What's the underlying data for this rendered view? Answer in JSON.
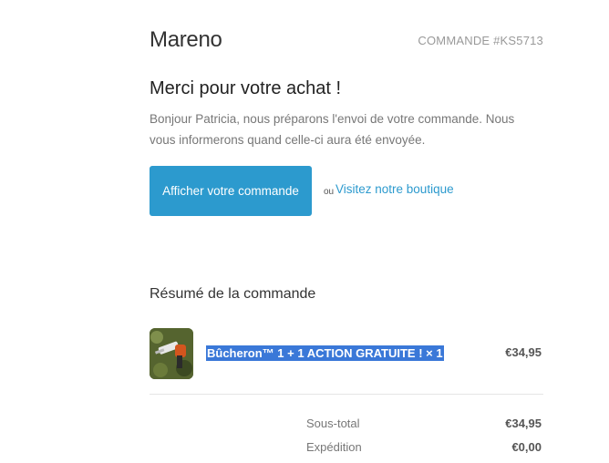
{
  "header": {
    "shop_name": "Mareno",
    "order_number": "COMMANDE #KS5713"
  },
  "message": {
    "title": "Merci pour votre achat !",
    "body": "Bonjour Patricia, nous préparons l'envoi de votre commande. Nous vous informerons quand celle-ci aura été envoyée."
  },
  "actions": {
    "view_order_label": "Afficher votre commande",
    "or_label": "ou",
    "visit_shop_label": "Visitez notre boutique"
  },
  "summary": {
    "title": "Résumé de la commande",
    "items": [
      {
        "title": "Bûcheron™ 1 + 1 ACTION GRATUITE ! × 1",
        "price": "€34,95",
        "thumbnail_icon": "product-thumbnail"
      }
    ],
    "totals": [
      {
        "label": "Sous-total",
        "value": "€34,95"
      },
      {
        "label": "Expédition",
        "value": "€0,00"
      }
    ]
  },
  "colors": {
    "accent": "#2c9ace",
    "selection": "#3a78d8",
    "muted_text": "#777777"
  }
}
